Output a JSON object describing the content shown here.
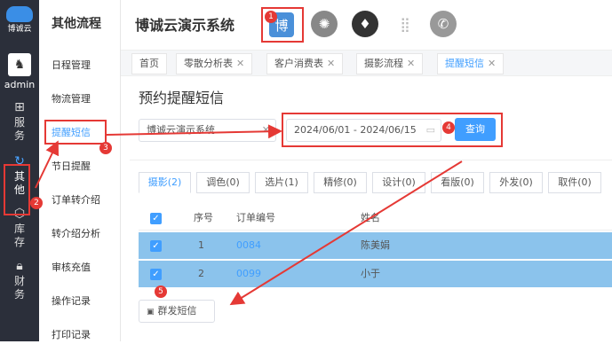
{
  "rail": {
    "logo_label": "博诚云",
    "user": "admin",
    "items": [
      {
        "icon": "grid-icon",
        "label": "服\n务"
      },
      {
        "icon": "refresh-icon",
        "label": "其\n他"
      },
      {
        "icon": "cube-icon",
        "label": "库\n存"
      },
      {
        "icon": "lock-icon",
        "label": "财\n务"
      }
    ]
  },
  "menu": {
    "title": "其他流程",
    "items": [
      "日程管理",
      "物流管理",
      "提醒短信",
      "节日提醒",
      "订单转介绍",
      "转介绍分析",
      "审核充值",
      "操作记录",
      "打印记录"
    ]
  },
  "topbar": {
    "system_name": "博诚云演示系统",
    "app_icon_char": "博"
  },
  "tabs": [
    {
      "label": "首页"
    },
    {
      "label": "零散分析表"
    },
    {
      "label": "客户消费表"
    },
    {
      "label": "摄影流程"
    },
    {
      "label": "提醒短信"
    }
  ],
  "page": {
    "title": "预约提醒短信",
    "store_select": "博诚云演示系统",
    "date_range": "2024/06/01 - 2024/06/15",
    "query_button": "查询"
  },
  "subtabs": [
    "摄影(2)",
    "调色(0)",
    "选片(1)",
    "精修(0)",
    "设计(0)",
    "看版(0)",
    "外发(0)",
    "取件(0)"
  ],
  "table": {
    "headers": {
      "seq": "序号",
      "order": "订单编号",
      "name": "姓名"
    },
    "rows": [
      {
        "seq": "1",
        "order": "0084",
        "name": "陈美娟"
      },
      {
        "seq": "2",
        "order": "0099",
        "name": "小于"
      }
    ]
  },
  "batch_button": "群发短信",
  "annotations": [
    "1",
    "2",
    "3",
    "4",
    "5"
  ],
  "colors": {
    "accent": "#409eff",
    "highlight": "#e53935",
    "selected_row": "#8bc3ec",
    "rail_bg": "#2b2f3a"
  }
}
